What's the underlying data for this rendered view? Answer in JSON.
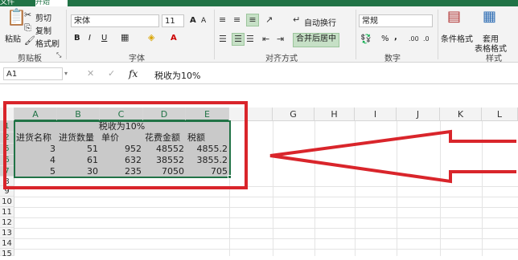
{
  "tabs": [
    "文件",
    "开始"
  ],
  "ribbon": {
    "clipboard": {
      "paste": "粘贴",
      "cut": "剪切",
      "copy": "复制",
      "format_painter": "格式刷",
      "group_label": "剪贴板"
    },
    "font": {
      "font_name": "宋体",
      "font_size": "11",
      "bold": "B",
      "italic": "I",
      "underline": "U",
      "grow": "A",
      "shrink": "A",
      "font_color": "A",
      "group_label": "字体"
    },
    "alignment": {
      "wrap_text": "自动换行",
      "merge_center": "合并后居中",
      "group_label": "对齐方式"
    },
    "number": {
      "format": "常规",
      "percent": "%",
      "comma": ",",
      "group_label": "数字"
    },
    "styles": {
      "conditional": "条件格式",
      "table_format_1": "套用",
      "table_format_2": "表格格式",
      "group_label": "样式"
    }
  },
  "formula_bar": {
    "name_box": "A1",
    "fx": "fx",
    "content": "税收为10%"
  },
  "grid": {
    "columns": [
      "A",
      "B",
      "C",
      "D",
      "E",
      "G",
      "H",
      "I",
      "J",
      "K",
      "L"
    ],
    "rows": [
      "1",
      "2",
      "5",
      "6",
      "7",
      "8",
      "9",
      "10",
      "11",
      "12",
      "13",
      "14",
      "15"
    ],
    "title": "税收为10%",
    "headers": [
      "进货名称",
      "进货数量",
      "单价",
      "花费金额",
      "税额"
    ],
    "data": [
      [
        "3",
        "51",
        "952",
        "48552",
        "4855.2"
      ],
      [
        "4",
        "61",
        "632",
        "38552",
        "3855.2"
      ],
      [
        "5",
        "30",
        "235",
        "7050",
        "705"
      ]
    ]
  },
  "colors": {
    "accent": "#217346",
    "annotation": "#d9252b",
    "selection": "#c9c9c9"
  }
}
